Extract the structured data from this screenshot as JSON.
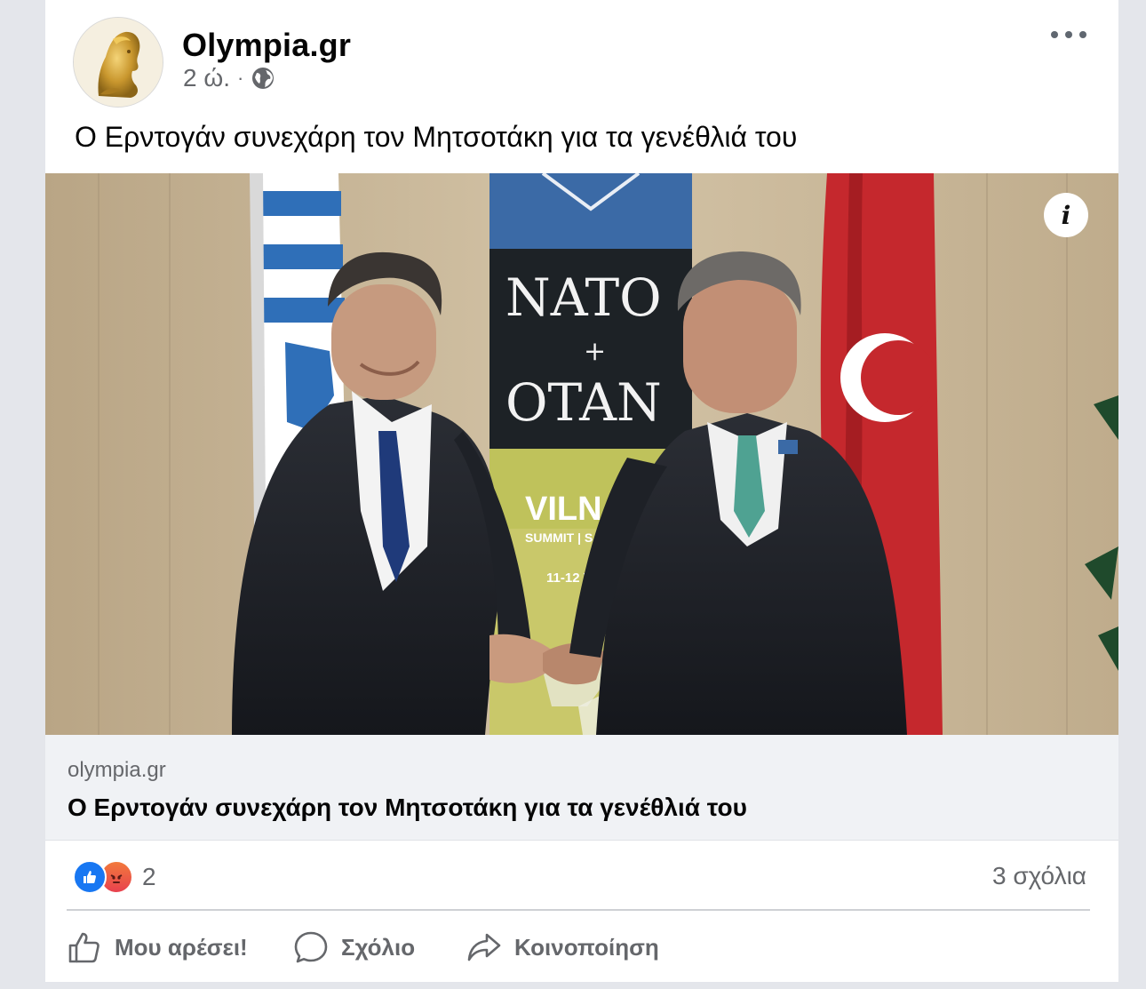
{
  "post": {
    "page_name": "Olympia.gr",
    "time": "2 ώ.",
    "separator": "·",
    "text": "Ο Ερντογάν συνεχάρη τον Μητσοτάκη για τα γενέθλιά του",
    "image": {
      "info_icon": "info-icon",
      "banner_lines": [
        "NATO",
        "+",
        "OTAN",
        "VILN",
        "SUMMIT | S",
        "11-12 V"
      ]
    },
    "link_preview": {
      "domain": "olympia.gr",
      "title": "Ο Ερντογάν συνεχάρη τον Μητσοτάκη για τα γενέθλιά του"
    },
    "reactions": {
      "types": [
        "like",
        "angry"
      ],
      "count": "2"
    },
    "comments_label": "3 σχόλια",
    "actions": {
      "like": "Μου αρέσει!",
      "comment": "Σχόλιο",
      "share": "Κοινοποίηση"
    }
  },
  "colors": {
    "like_blue": "#1877f2",
    "secondary_text": "#65676b",
    "link_bg": "#f0f2f5"
  }
}
